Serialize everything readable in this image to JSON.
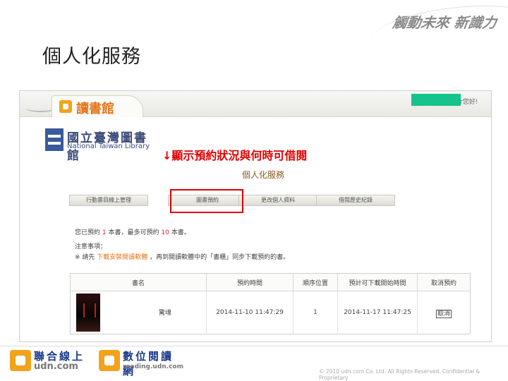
{
  "slide": {
    "title": "個人化服務",
    "brand": "觸動未來 新識力"
  },
  "app": {
    "reading_tab": "讀書館",
    "welcome_text": "r您好!"
  },
  "library": {
    "name_cn": "國立臺灣圖書館",
    "name_en": "National Taiwan Library"
  },
  "annotation": "↓顯示預約狀況與何時可借閱",
  "page_heading": "個人化服務",
  "nav_tabs": [
    "行動書目線上管理",
    "圖書預約",
    "更改個人資料",
    "借閱歷史紀錄"
  ],
  "reservation_info": {
    "line1_prefix": "您已預約",
    "reserved_count": "1",
    "line1_mid": "本書，最多可預約",
    "max_count": "10",
    "line1_suffix": "本書。",
    "notes_label": "注意事項：",
    "line3_prefix": "※ 請先",
    "line3_link": "下載安裝閱讀軟體",
    "line3_suffix": "，再到閱讀軟體中的「書櫃」同步下載預約的書。"
  },
  "table": {
    "headers": [
      "書名",
      "預約時間",
      "順序位置",
      "預計可下載開始時間",
      "取消預約"
    ],
    "rows": [
      {
        "title": "驚魂",
        "reserved_time": "2014-11-10 11:47:29",
        "queue": "1",
        "available_time": "2014-11-17 11:47:25",
        "cancel": "取消"
      }
    ]
  },
  "footer": {
    "logo1_cn": "聯合線上",
    "logo1_en": "udn.com",
    "logo2_cn": "數位閱讀網",
    "logo2_en": "reading.udn.com",
    "copyright": "© 2010 udn.com Co. Ltd. All Rights Reserved. Confidential & Proprietary"
  }
}
